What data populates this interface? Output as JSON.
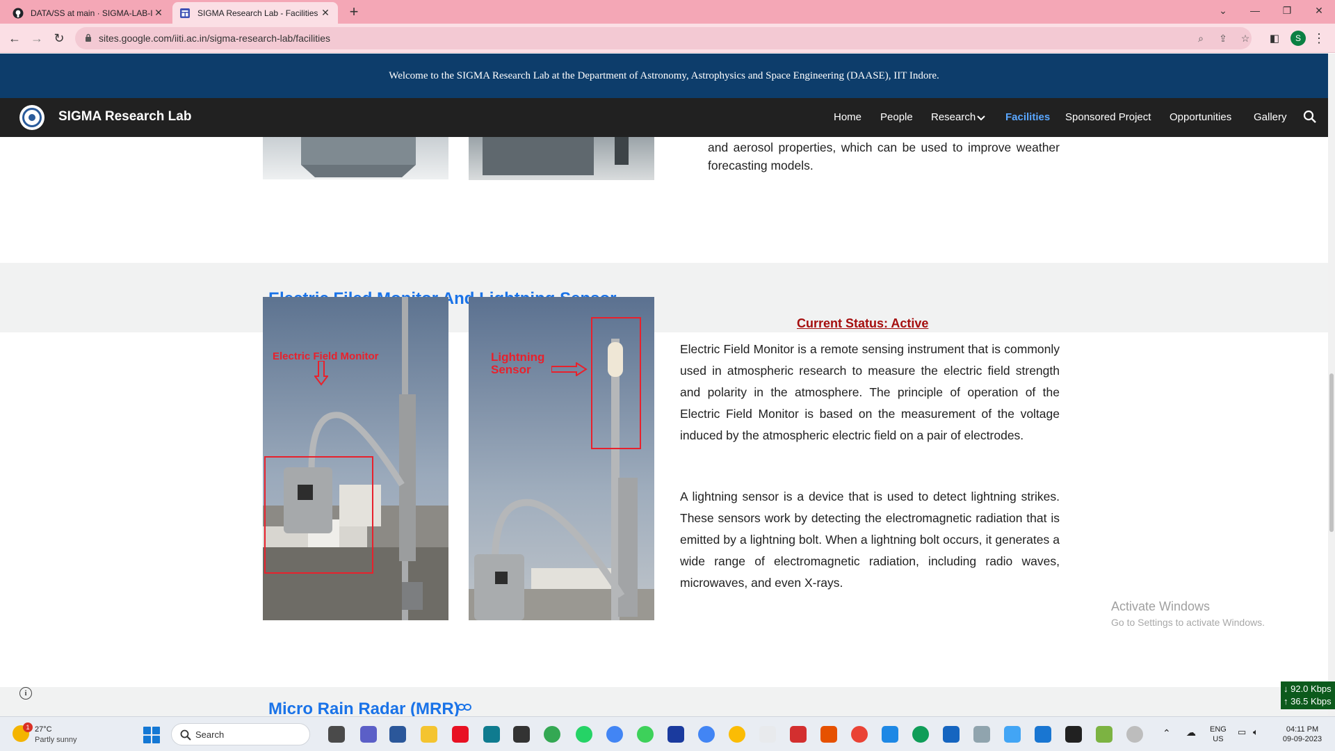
{
  "browser": {
    "tabs": [
      {
        "title": "DATA/SS at main · SIGMA-LAB-IIT",
        "active": false
      },
      {
        "title": "SIGMA Research Lab - Facilities",
        "active": true
      }
    ],
    "url": "sites.google.com/iiti.ac.in/sigma-research-lab/facilities",
    "profile_initial": "S"
  },
  "site": {
    "banner": "Welcome to the SIGMA Research Lab at the Department of Astronomy, Astrophysics and Space Engineering (DAASE), IIT Indore.",
    "name": "SIGMA Research Lab",
    "nav": [
      {
        "label": "Home"
      },
      {
        "label": "People"
      },
      {
        "label": "Research"
      },
      {
        "label": "Facilities"
      },
      {
        "label": "Sponsored Project"
      },
      {
        "label": "Opportunities"
      },
      {
        "label": "Gallery"
      }
    ]
  },
  "content": {
    "prev_section_tail": "and aerosol properties, which can be used to improve weather forecasting models.",
    "section": {
      "heading": "Electric Filed Monitor And Lightning Sensor",
      "photo1_label": "Electric Field Monitor",
      "photo2_label_line1": "Lightning",
      "photo2_label_line2": "Sensor",
      "status": "Current Status: Active",
      "paragraph1": "Electric Field Monitor is a remote sensing instrument that is commonly used in atmospheric research to measure the electric field strength and polarity in the atmosphere. The principle of operation of the Electric Field Monitor is based on the measurement of the voltage induced by the atmospheric electric field on a pair of electrodes.",
      "paragraph2": "A lightning sensor is a device that is used to detect lightning strikes. These sensors work by detecting the electromagnetic radiation that is emitted by a lightning bolt. When a lightning bolt occurs, it generates a wide range of electromagnetic radiation, including radio waves, microwaves, and even X-rays."
    },
    "next_heading": "Micro Rain Radar (MRR)"
  },
  "overlay": {
    "watermark_title": "Activate Windows",
    "watermark_sub": "Go to Settings to activate Windows.",
    "net_down": "↓ 92.0 Kbps",
    "net_up": "↑ 36.5 Kbps"
  },
  "taskbar": {
    "weather_temp": "27°C",
    "weather_desc": "Partly sunny",
    "weather_badge": "1",
    "search_label": "Search",
    "lang_line1": "ENG",
    "lang_line2": "US",
    "time": "04:11 PM",
    "date": "09-09-2023"
  }
}
